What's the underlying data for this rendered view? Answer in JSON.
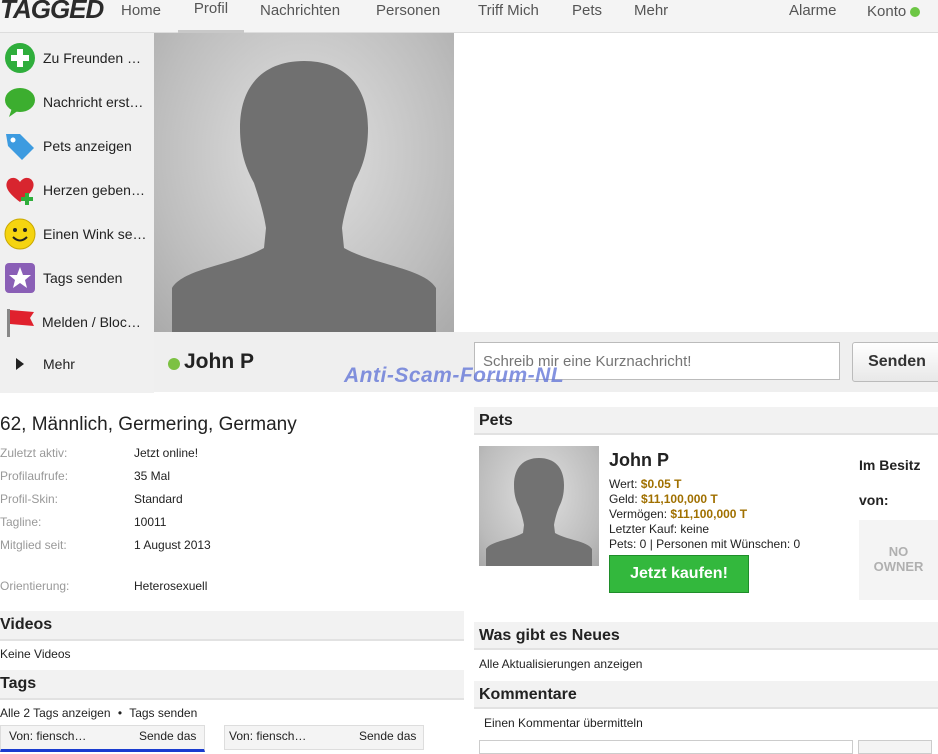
{
  "nav": {
    "logo": "TAGGED",
    "items": [
      "Home",
      "Profil",
      "Nachrichten",
      "Personen",
      "Triff Mich",
      "Pets",
      "Mehr"
    ],
    "alarme": "Alarme",
    "konto": "Konto"
  },
  "sidebar": {
    "items": [
      {
        "label": "Zu Freunden …",
        "icon": "add-friend-icon"
      },
      {
        "label": "Nachricht erst…",
        "icon": "speech-bubble-icon"
      },
      {
        "label": "Pets anzeigen",
        "icon": "price-tag-icon"
      },
      {
        "label": "Herzen geben…",
        "icon": "heart-plus-icon"
      },
      {
        "label": "Einen Wink se…",
        "icon": "smiley-icon"
      },
      {
        "label": "Tags senden",
        "icon": "star-icon"
      },
      {
        "label": "Melden / Bloc…",
        "icon": "flag-icon"
      },
      {
        "label": "Mehr",
        "icon": "play-arrow-icon"
      }
    ]
  },
  "profile": {
    "name": "John P",
    "message_placeholder": "Schreib mir eine Kurznachricht!",
    "send_label": "Senden",
    "watermark": "Anti-Scam-Forum-NL",
    "summary": "62, Männlich, Germering, Germany",
    "info": [
      {
        "key": "Zuletzt aktiv:",
        "value": "Jetzt online!"
      },
      {
        "key": "Profilaufrufe:",
        "value": "35 Mal"
      },
      {
        "key": "Profil-Skin:",
        "value": "Standard"
      },
      {
        "key": "Tagline:",
        "value": "10011"
      },
      {
        "key": "Mitglied seit:",
        "value": "1 August 2013"
      },
      {
        "key": "Orientierung:",
        "value": "Heterosexuell"
      }
    ]
  },
  "videos": {
    "title": "Videos",
    "empty": "Keine Videos"
  },
  "tags": {
    "title": "Tags",
    "show_all": "Alle 2 Tags anzeigen",
    "send": "Tags senden",
    "items": [
      {
        "from": "Von: fiensch…",
        "action": "Sende das"
      },
      {
        "from": "Von: fiensch…",
        "action": "Sende das"
      }
    ]
  },
  "pets": {
    "title": "Pets",
    "name": "John P",
    "wert_label": "Wert:",
    "wert_value": "$0.05 T",
    "geld_label": "Geld:",
    "geld_value": "$11,100,000 T",
    "vermoegen_label": "Vermögen:",
    "vermoegen_value": "$11,100,000 T",
    "letzter_kauf": "Letzter Kauf: keine",
    "counts": "Pets: 0 | Personen mit Wünschen: 0",
    "buy_label": "Jetzt kaufen!",
    "owner_label_1": "Im Besitz",
    "owner_label_2": "von:",
    "no_owner_1": "NO",
    "no_owner_2": "OWNER"
  },
  "news": {
    "title": "Was gibt es Neues",
    "link": "Alle Aktualisierungen anzeigen"
  },
  "comments": {
    "title": "Kommentare",
    "link": "Einen Kommentar übermitteln"
  }
}
